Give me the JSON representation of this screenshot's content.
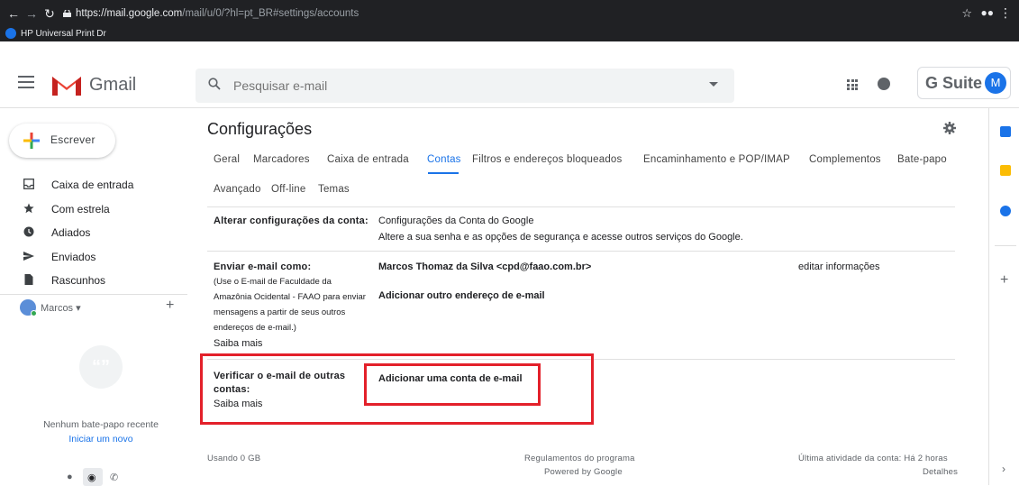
{
  "browser": {
    "url_host": "https://mail.google.com",
    "url_path": "/mail/u/0/?hl=pt_BR#settings/accounts",
    "bookmark": "HP Universal Print Dr"
  },
  "header": {
    "app_name": "Gmail",
    "search_placeholder": "Pesquisar e-mail",
    "gsuite_label": "G Suite",
    "avatar_letter": "M"
  },
  "sidebar": {
    "compose_label": "Escrever",
    "items": [
      {
        "label": "Caixa de entrada",
        "icon": "inbox-icon"
      },
      {
        "label": "Com estrela",
        "icon": "star-icon"
      },
      {
        "label": "Adiados",
        "icon": "clock-icon"
      },
      {
        "label": "Enviados",
        "icon": "send-icon"
      },
      {
        "label": "Rascunhos",
        "icon": "draft-icon"
      }
    ],
    "user_name": "Marcos",
    "no_chat": "Nenhum bate-papo recente",
    "start_new": "Iniciar um novo"
  },
  "settings": {
    "title": "Configurações",
    "tabs": [
      "Geral",
      "Marcadores",
      "Caixa de entrada",
      "Contas",
      "Filtros e endereços bloqueados",
      "Encaminhamento e POP/IMAP",
      "Complementos",
      "Bate-papo",
      "Avançado",
      "Off-line",
      "Temas"
    ],
    "active_tab": "Contas",
    "account": {
      "label": "Alterar configurações da conta:",
      "link": "Configurações da Conta do Google",
      "desc": "Altere a sua senha e as opções de segurança e acesse outros serviços do Google."
    },
    "send_as": {
      "label": "Enviar e-mail como:",
      "sub": "(Use o E-mail de Faculdade da Amazônia Ocidental - FAAO para enviar mensagens a partir de seus outros endereços de e-mail.)",
      "learn_more": "Saiba mais",
      "address": "Marcos Thomaz da Silva <cpd@faao.com.br>",
      "edit": "editar informações",
      "add": "Adicionar outro endereço de e-mail"
    },
    "check_mail": {
      "label": "Verificar o e-mail de outras contas:",
      "learn_more": "Saiba mais",
      "add": "Adicionar uma conta de e-mail"
    }
  },
  "footer": {
    "usage": "Usando 0 GB",
    "policies": "Regulamentos do programa",
    "powered": "Powered by Google",
    "last_activity": "Última atividade da conta: Há 2 horas",
    "details": "Detalhes"
  },
  "colors": {
    "accent": "#1a73e8",
    "highlight": "#e3202a"
  }
}
